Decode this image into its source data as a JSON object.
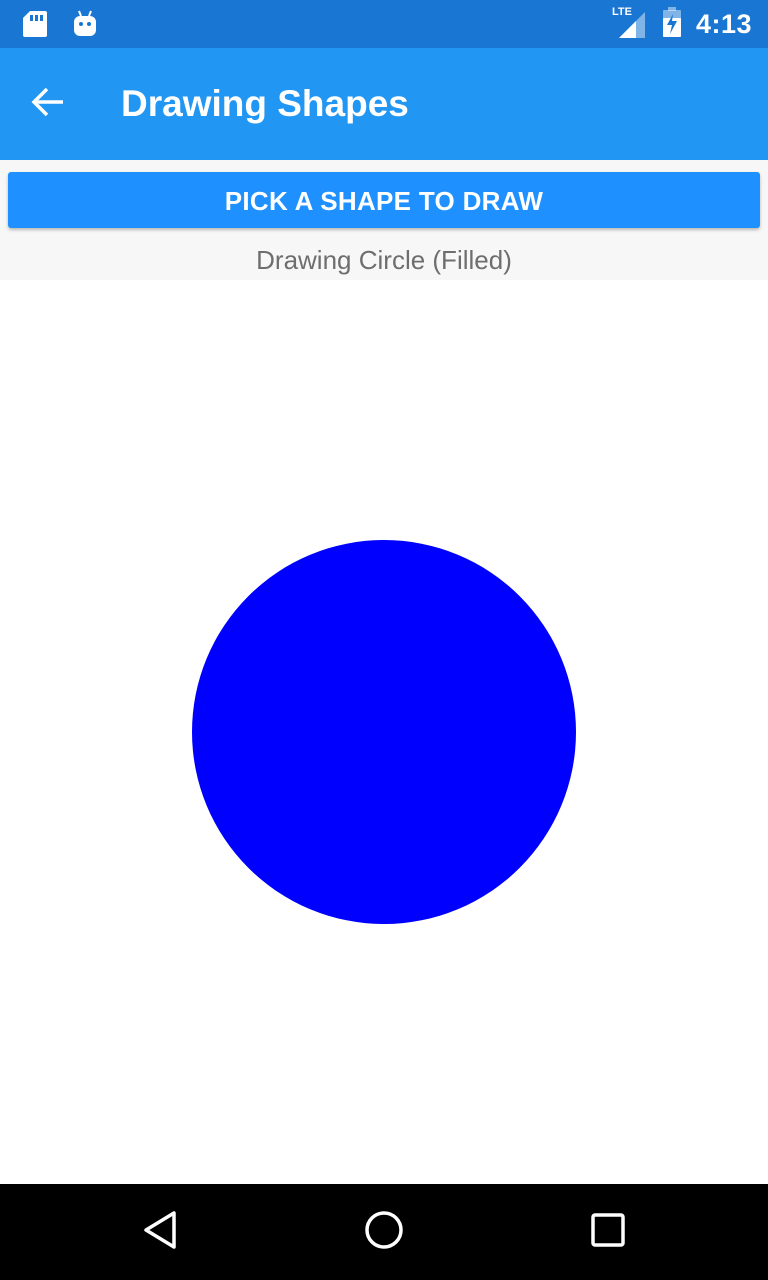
{
  "status_bar": {
    "time": "4:13",
    "network_label": "LTE",
    "icons": [
      "sd-card-icon",
      "android-icon",
      "lte-signal-icon",
      "battery-icon"
    ]
  },
  "app_bar": {
    "title": "Drawing Shapes",
    "back_icon": "arrow-back-icon"
  },
  "controls": {
    "pick_button_label": "PICK A SHAPE TO DRAW",
    "status_text": "Drawing Circle (Filled)"
  },
  "canvas": {
    "shape": "circle",
    "fill": "filled",
    "color": "#0000FF"
  },
  "nav_bar": {
    "buttons": [
      "back-triangle-icon",
      "home-circle-icon",
      "recents-square-icon"
    ]
  },
  "colors": {
    "status_bar": "#1976D2",
    "app_bar": "#2196F3",
    "button": "#1E90FF",
    "shape": "#0000FF"
  }
}
